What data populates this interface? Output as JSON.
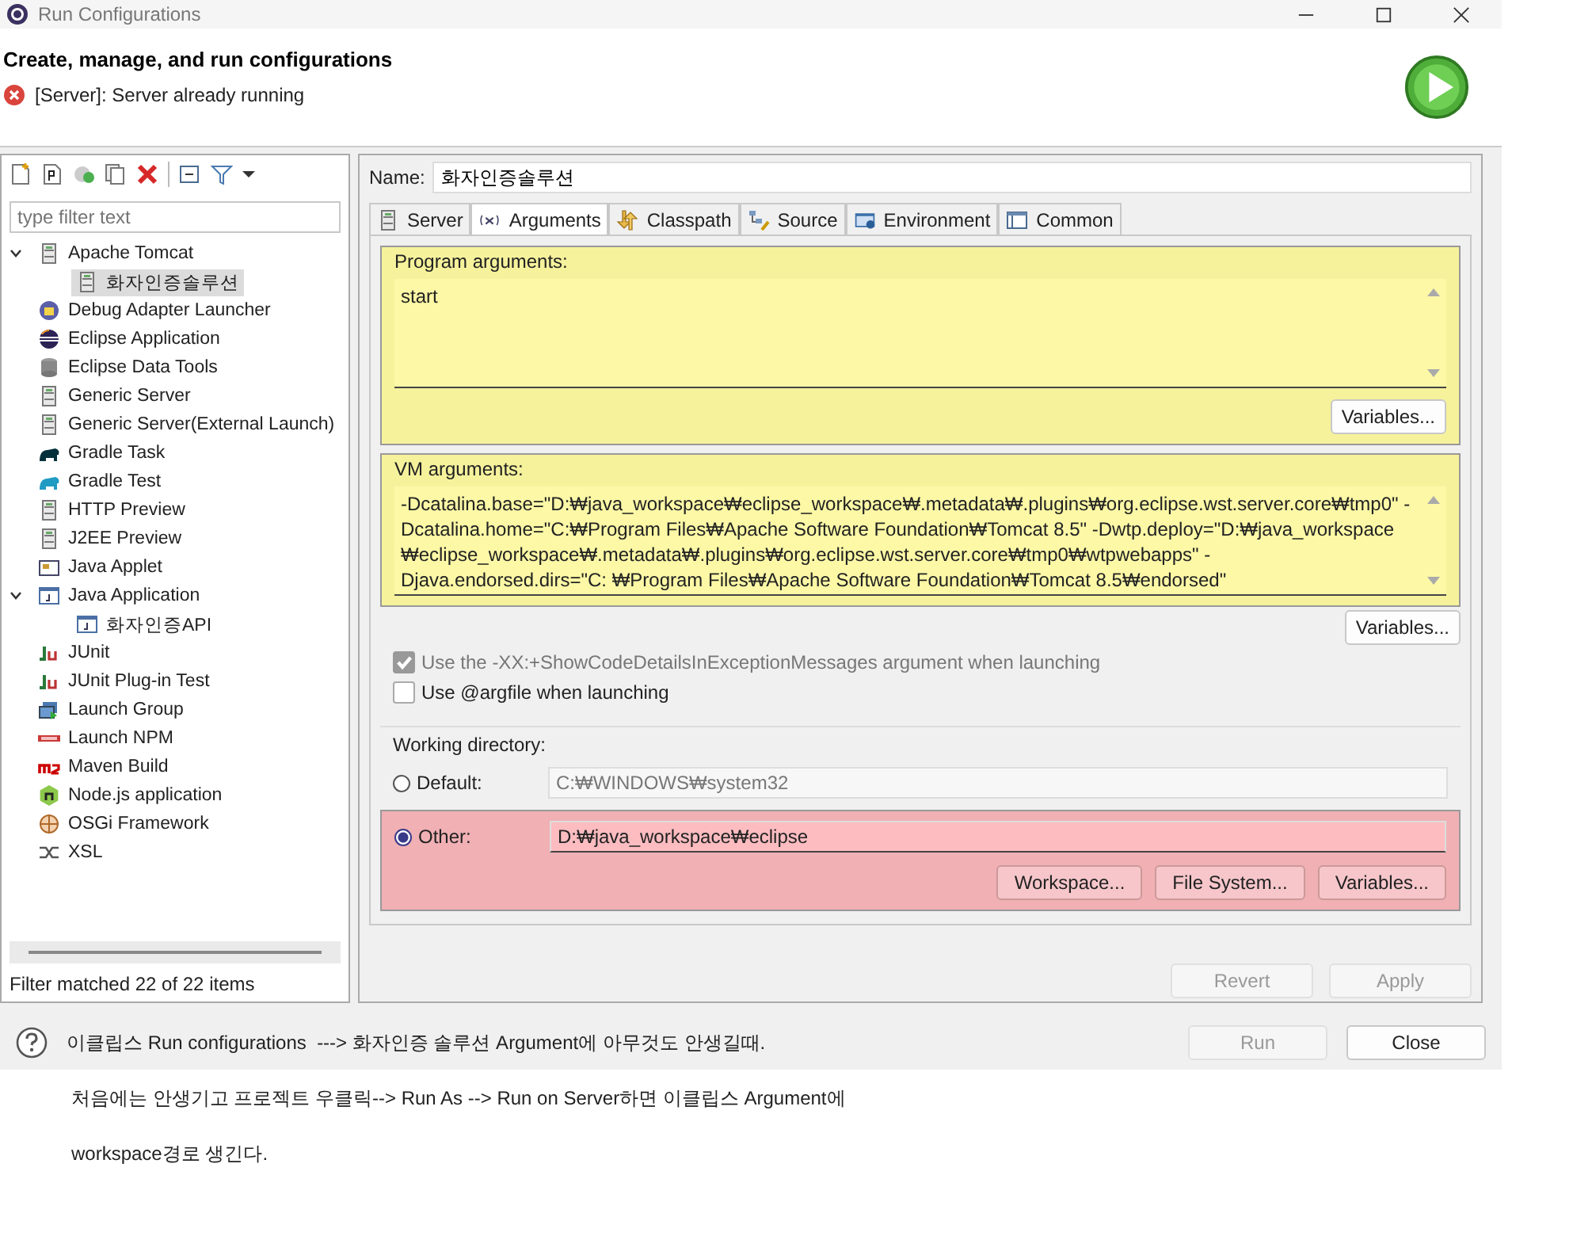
{
  "window": {
    "title": "Run Configurations"
  },
  "header": {
    "title": "Create, manage, and run configurations",
    "message": "[Server]: Server already running"
  },
  "filter": {
    "placeholder": "type filter text"
  },
  "tree": [
    {
      "label": "Apache Tomcat",
      "kind": "server",
      "selected": false,
      "expanded": true,
      "children": [
        {
          "label": "화자인증솔루션",
          "kind": "server",
          "selected": true
        }
      ]
    },
    {
      "label": "Debug Adapter Launcher",
      "kind": "debug",
      "selected": false
    },
    {
      "label": "Eclipse Application",
      "kind": "eclipse",
      "selected": false
    },
    {
      "label": "Eclipse Data Tools",
      "kind": "database",
      "selected": false
    },
    {
      "label": "Generic Server",
      "kind": "server",
      "selected": false
    },
    {
      "label": "Generic Server(External Launch)",
      "kind": "server",
      "selected": false
    },
    {
      "label": "Gradle Task",
      "kind": "gradle",
      "selected": false
    },
    {
      "label": "Gradle Test",
      "kind": "gradle-test",
      "selected": false
    },
    {
      "label": "HTTP Preview",
      "kind": "server",
      "selected": false
    },
    {
      "label": "J2EE Preview",
      "kind": "server",
      "selected": false
    },
    {
      "label": "Java Applet",
      "kind": "applet",
      "selected": false
    },
    {
      "label": "Java Application",
      "kind": "java",
      "selected": false,
      "expanded": true,
      "children": [
        {
          "label": "화자인증API",
          "kind": "java",
          "selected": false
        }
      ]
    },
    {
      "label": "JUnit",
      "kind": "junit",
      "selected": false
    },
    {
      "label": "JUnit Plug-in Test",
      "kind": "junit",
      "selected": false
    },
    {
      "label": "Launch Group",
      "kind": "group",
      "selected": false
    },
    {
      "label": "Launch NPM",
      "kind": "npm",
      "selected": false
    },
    {
      "label": "Maven Build",
      "kind": "maven",
      "selected": false
    },
    {
      "label": "Node.js application",
      "kind": "node",
      "selected": false
    },
    {
      "label": "OSGi Framework",
      "kind": "osgi",
      "selected": false
    },
    {
      "label": "XSL",
      "kind": "xsl",
      "selected": false
    }
  ],
  "filter_status": "Filter matched 22 of 22 items",
  "name": {
    "label": "Name:",
    "value": "화자인증솔루션"
  },
  "tabs": [
    {
      "label": "Server",
      "selected": false
    },
    {
      "label": "Arguments",
      "selected": true
    },
    {
      "label": "Classpath",
      "selected": false
    },
    {
      "label": "Source",
      "selected": false
    },
    {
      "label": "Environment",
      "selected": false
    },
    {
      "label": "Common",
      "selected": false
    }
  ],
  "program_arguments": {
    "label": "Program arguments:",
    "value": "start",
    "highlighted": true,
    "button": "Variables..."
  },
  "vm_arguments": {
    "label": "VM arguments:",
    "value": "-Dcatalina.base=\"D:₩java_workspace₩eclipse_workspace₩.metadata₩.plugins₩org.eclipse.wst.server.core₩tmp0\" -Dcatalina.home=\"C:₩Program Files₩Apache Software Foundation₩Tomcat 8.5\" -Dwtp.deploy=\"D:₩java_workspace ₩eclipse_workspace₩.metadata₩.plugins₩org.eclipse.wst.server.core₩tmp0₩wtpwebapps\" -Djava.endorsed.dirs=\"C: ₩Program Files₩Apache Software Foundation₩Tomcat 8.5₩endorsed\"",
    "highlighted": true,
    "button": "Variables..."
  },
  "options": [
    {
      "label": "Use the -XX:+ShowCodeDetailsInExceptionMessages argument when launching",
      "checked": true,
      "disabled": true
    },
    {
      "label": "Use @argfile when launching",
      "checked": false,
      "disabled": false
    }
  ],
  "working_directory": {
    "label": "Working directory:",
    "options": [
      {
        "label": "Default:",
        "value": "C:₩WINDOWS₩system32",
        "selected": false,
        "highlighted": false
      },
      {
        "label": "Other:",
        "value": "D:₩java_workspace₩eclipse",
        "selected": true,
        "highlighted": true,
        "buttons": [
          "Workspace...",
          "File System...",
          "Variables..."
        ]
      }
    ]
  },
  "actions": [
    {
      "label": "Revert",
      "disabled": true
    },
    {
      "label": "Apply",
      "disabled": true
    }
  ],
  "footer": {
    "note": "이클립스 Run configurations  ---> 화자인증 솔루션 Argument에 아무것도 안생길때.",
    "buttons": [
      {
        "label": "Run",
        "disabled": true
      },
      {
        "label": "Close",
        "disabled": false
      }
    ]
  },
  "notes": [
    "처음에는 안생기고 프로젝트 우클릭--> Run As --> Run on Server하면 이클립스 Argument에",
    "workspace경로 생긴다."
  ]
}
